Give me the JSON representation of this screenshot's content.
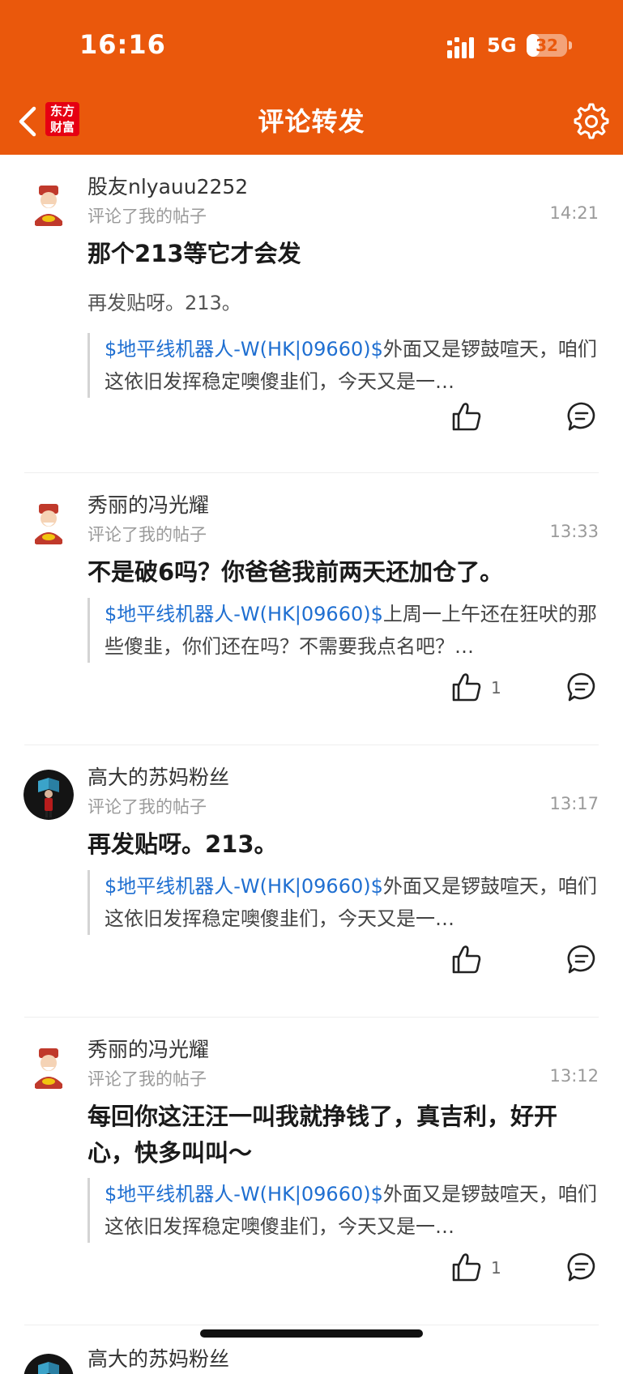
{
  "status_bar": {
    "time": "16:16",
    "network": "5G",
    "battery": "32",
    "battery_level": 0.32
  },
  "header": {
    "logo_text": "东方财富",
    "logo_line1": "东方",
    "logo_line2": "财富",
    "title": "评论转发"
  },
  "colors": {
    "header_bg": "#ea580c",
    "stock_link": "#1f6fd1",
    "muted": "#9a9a9a"
  },
  "comments": [
    {
      "user": "股友nlyauu2252",
      "avatar": "caishen-avatar",
      "action": "评论了我的帖子",
      "time": "14:21",
      "content": "那个213等它才会发",
      "sub": "再发贴呀。213。",
      "quote_stock": "$地平线机器人-W(HK|09660)$",
      "quote_text": "外面又是锣鼓喧天，咱们这依旧发挥稳定噢傻韭们，今天又是一…",
      "likes": ""
    },
    {
      "user": "秀丽的冯光耀",
      "avatar": "caishen-avatar",
      "action": "评论了我的帖子",
      "time": "13:33",
      "content": "不是破6吗？你爸爸我前两天还加仓了。",
      "sub": "",
      "quote_stock": "$地平线机器人-W(HK|09660)$",
      "quote_text": "上周一上午还在狂吠的那些傻韭，你们还在吗？不需要我点名吧？…",
      "likes": "1"
    },
    {
      "user": "高大的苏妈粉丝",
      "avatar": "photo-avatar",
      "action": "评论了我的帖子",
      "time": "13:17",
      "content": "再发贴呀。213。",
      "sub": "",
      "quote_stock": "$地平线机器人-W(HK|09660)$",
      "quote_text": "外面又是锣鼓喧天，咱们这依旧发挥稳定噢傻韭们，今天又是一…",
      "likes": ""
    },
    {
      "user": "秀丽的冯光耀",
      "avatar": "caishen-avatar",
      "action": "评论了我的帖子",
      "time": "13:12",
      "content": "每回你这汪汪一叫我就挣钱了，真吉利，好开心，快多叫叫～",
      "sub": "",
      "quote_stock": "$地平线机器人-W(HK|09660)$",
      "quote_text": "外面又是锣鼓喧天，咱们这依旧发挥稳定噢傻韭们，今天又是一…",
      "likes": "1"
    },
    {
      "user": "高大的苏妈粉丝",
      "avatar": "photo-avatar"
    }
  ]
}
